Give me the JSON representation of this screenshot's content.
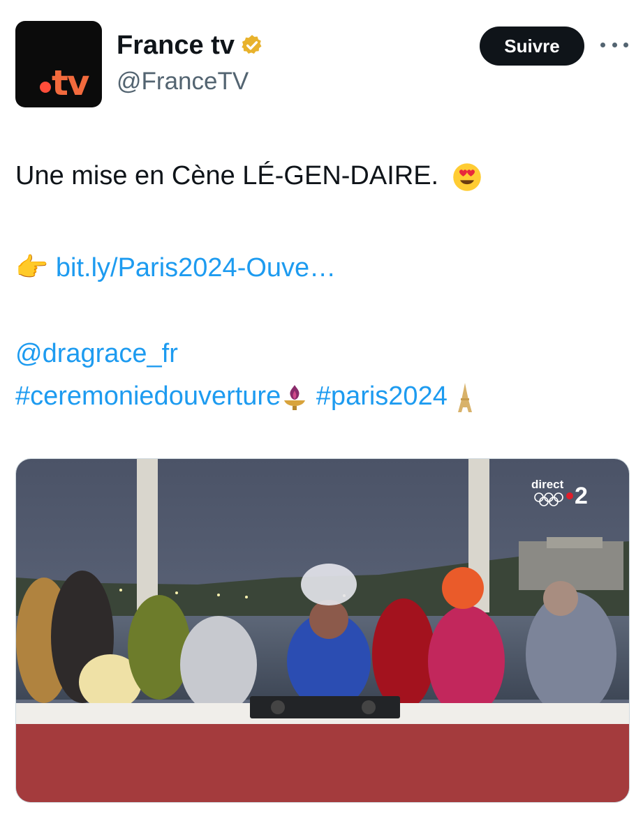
{
  "account": {
    "display_name": "France tv",
    "handle": "@FranceTV",
    "avatar_logo": "tv",
    "avatar_icon": "france-tv-logo",
    "verified_icon": "gold-verified-badge"
  },
  "actions": {
    "follow_label": "Suivre",
    "more_icon": "more-dots-icon"
  },
  "tweet": {
    "line1": "Une mise en Cène LÉ-GEN-DAIRE.",
    "line1_emoji": "heart-eyes-emoji",
    "pointer_emoji": "👉",
    "link_text": "bit.ly/Paris2024-Ouve…",
    "mention": "@dragrace_fr",
    "hashtag1": "#ceremoniedouverture",
    "hashtag1_emoji": "olympic-cauldron-emoji",
    "hashtag2": "#paris2024",
    "hashtag2_emoji": "eiffel-tower-emoji"
  },
  "media": {
    "broadcast_badge_text": "direct",
    "channel_number": "2",
    "description_icon": "tv-broadcast-still"
  },
  "colors": {
    "link": "#1d9bf0",
    "text": "#0f1419",
    "secondary": "#536471",
    "brand_orange": "#f26a3d"
  }
}
